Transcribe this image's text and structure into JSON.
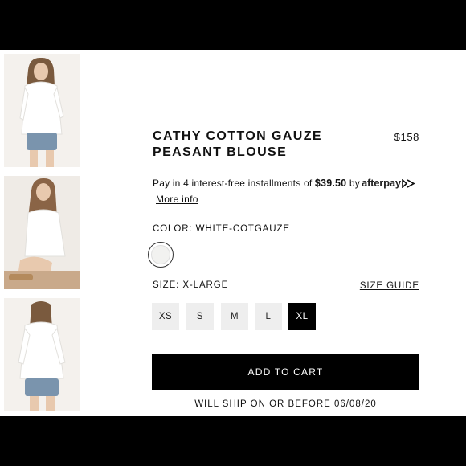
{
  "product": {
    "title_line1": "CATHY COTTON GAUZE",
    "title_line2": "PEASANT BLOUSE",
    "price": "$158"
  },
  "afterpay": {
    "text_before": "Pay in 4 interest-free installments of",
    "amount": "$39.50",
    "text_after": "by",
    "brand": "afterpay",
    "more_info": "More info",
    "brand_color": "#111111",
    "icon": "afterpay-arrows-icon"
  },
  "color": {
    "label": "COLOR: WHITE-COTGAUZE",
    "swatch_color": "#f2f2f0"
  },
  "size": {
    "label": "SIZE: X-LARGE",
    "guide": "SIZE GUIDE",
    "options": [
      "XS",
      "S",
      "M",
      "L",
      "XL"
    ],
    "selected": "XL"
  },
  "cart": {
    "label": "ADD TO CART"
  },
  "shipping": {
    "note": "WILL SHIP ON OR BEFORE 06/08/20"
  },
  "thumbnails": [
    "front-view",
    "seated-view",
    "back-view"
  ]
}
